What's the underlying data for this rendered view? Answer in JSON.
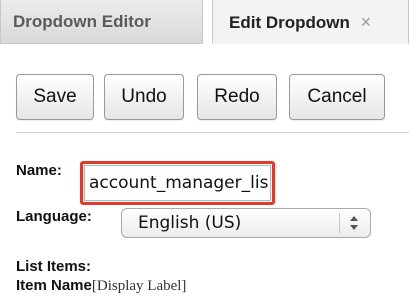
{
  "tabs": [
    {
      "label": "Dropdown Editor",
      "active": false
    },
    {
      "label": "Edit Dropdown",
      "active": true,
      "close_glyph": "×"
    }
  ],
  "toolbar": {
    "save": "Save",
    "undo": "Undo",
    "redo": "Redo",
    "cancel": "Cancel"
  },
  "form": {
    "name_label": "Name:",
    "name_value": "account_manager_lis",
    "language_label": "Language:",
    "language_value": "English (US)",
    "list_items_label": "List Items:",
    "item_name_label": "Item Name",
    "display_label": "[Display Label]"
  },
  "colors": {
    "highlight": "#e23a2a"
  },
  "icons": {
    "select_arrows": "updown-arrows-icon",
    "close": "close-icon"
  }
}
